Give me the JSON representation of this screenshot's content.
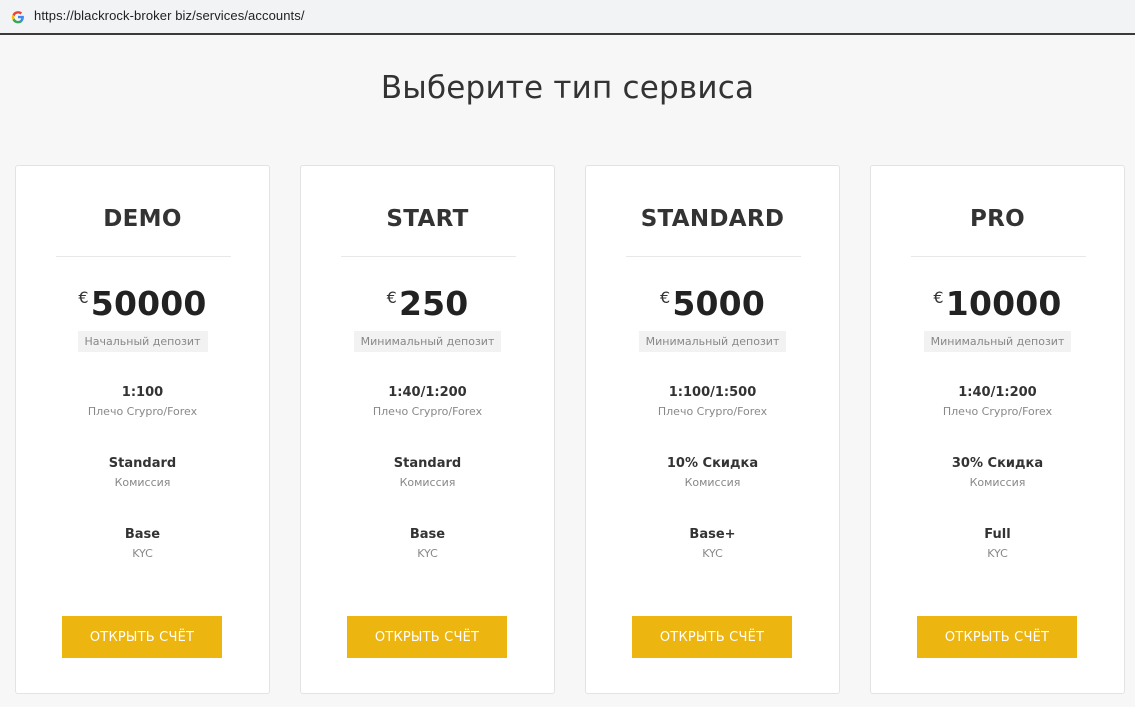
{
  "browser": {
    "url": "https://blackrock-broker biz/services/accounts/"
  },
  "page": {
    "title": "Выберите тип сервиса"
  },
  "colors": {
    "accent": "#ecb50f",
    "background": "#f7f7f7",
    "card": "#ffffff"
  },
  "plans": [
    {
      "name": "DEMO",
      "currency": "€",
      "amount": "50000",
      "deposit_label": "Начальный депозит",
      "leverage_value": "1:100",
      "leverage_label": "Плечо Crypro/Forex",
      "commission_value": "Standard",
      "commission_label": "Комиссия",
      "kyc_value": "Base",
      "kyc_label": "KYC",
      "button_label": "ОТКРЫТЬ СЧЁТ"
    },
    {
      "name": "START",
      "currency": "€",
      "amount": "250",
      "deposit_label": "Минимальный депозит",
      "leverage_value": "1:40/1:200",
      "leverage_label": "Плечо Crypro/Forex",
      "commission_value": "Standard",
      "commission_label": "Комиссия",
      "kyc_value": "Base",
      "kyc_label": "KYC",
      "button_label": "ОТКРЫТЬ СЧЁТ"
    },
    {
      "name": "STANDARD",
      "currency": "€",
      "amount": "5000",
      "deposit_label": "Минимальный депозит",
      "leverage_value": "1:100/1:500",
      "leverage_label": "Плечо Crypro/Forex",
      "commission_value": "10% Скидка",
      "commission_label": "Комиссия",
      "kyc_value": "Base+",
      "kyc_label": "KYC",
      "button_label": "ОТКРЫТЬ СЧЁТ"
    },
    {
      "name": "PRO",
      "currency": "€",
      "amount": "10000",
      "deposit_label": "Минимальный депозит",
      "leverage_value": "1:40/1:200",
      "leverage_label": "Плечо Crypro/Forex",
      "commission_value": "30% Скидка",
      "commission_label": "Комиссия",
      "kyc_value": "Full",
      "kyc_label": "KYC",
      "button_label": "ОТКРЫТЬ СЧЁТ"
    }
  ]
}
